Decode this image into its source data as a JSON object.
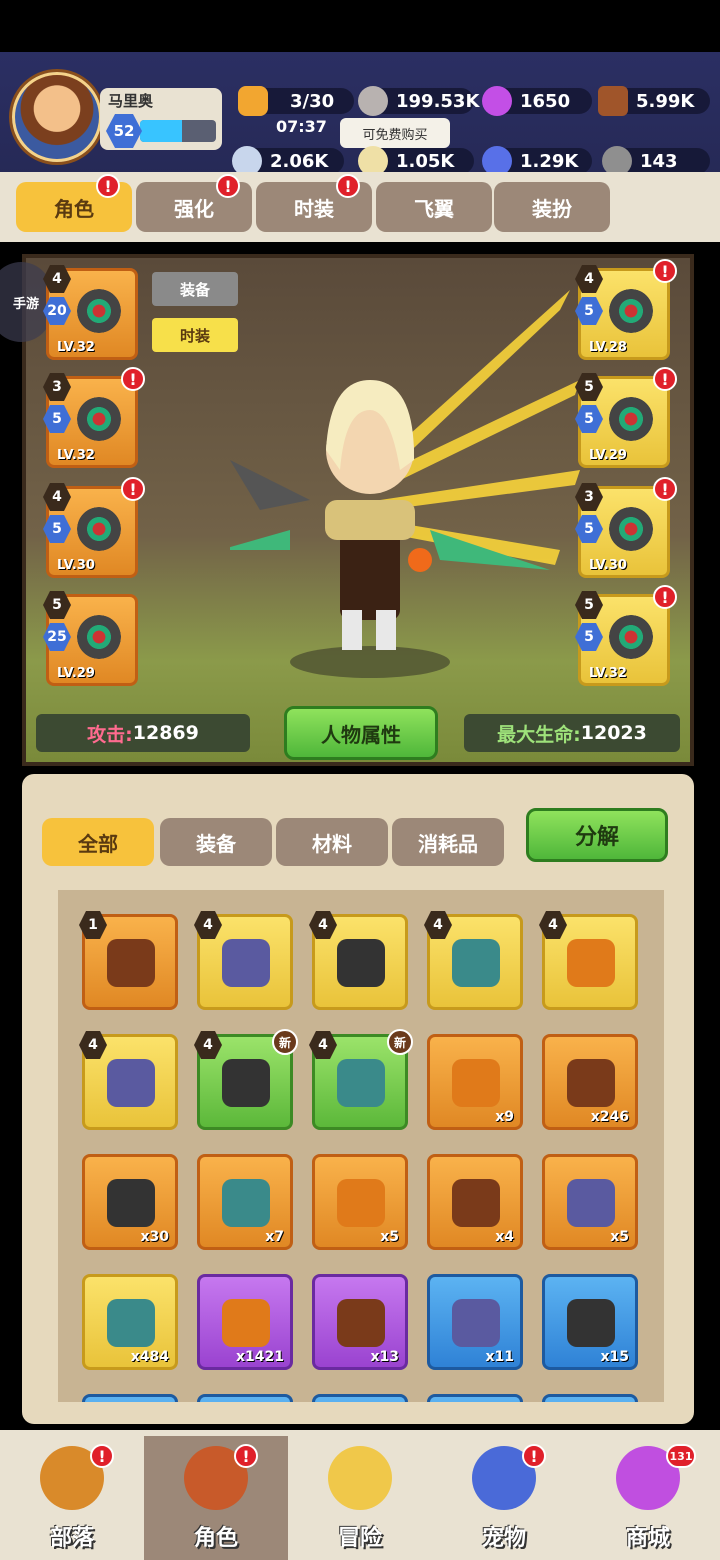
{
  "player": {
    "name": "马里奥",
    "level": "52",
    "xp_fraction": 0.55
  },
  "resources": {
    "stamina": "3/30",
    "timer": "07:37",
    "ore": "199.53K",
    "gems": "1650",
    "wood": "5.99K",
    "bone": "2.06K",
    "egg": "1.05K",
    "crystal": "1.29K",
    "stone": "143",
    "free_tooltip": "可免费购买"
  },
  "tabs": [
    {
      "label": "角色",
      "alert": "!"
    },
    {
      "label": "强化",
      "alert": "!"
    },
    {
      "label": "时装",
      "alert": "!"
    },
    {
      "label": "飞翼",
      "alert": ""
    },
    {
      "label": "装扮",
      "alert": ""
    }
  ],
  "side_tag": "手游",
  "mode_buttons": {
    "equip": "装备",
    "fashion": "时装"
  },
  "left_slots": [
    {
      "star": "4",
      "level": "20",
      "lv": "LV.32"
    },
    {
      "star": "3",
      "level": "5",
      "lv": "LV.32"
    },
    {
      "star": "4",
      "level": "5",
      "lv": "LV.30"
    },
    {
      "star": "5",
      "level": "25",
      "lv": "LV.29"
    }
  ],
  "right_slots": [
    {
      "star": "4",
      "level": "5",
      "lv": "LV.28"
    },
    {
      "star": "5",
      "level": "5",
      "lv": "LV.29"
    },
    {
      "star": "3",
      "level": "5",
      "lv": "LV.30"
    },
    {
      "star": "5",
      "level": "5",
      "lv": "LV.32"
    }
  ],
  "stats": {
    "attack_label": "攻击:",
    "attack": "12869",
    "attr_button": "人物属性",
    "hp_label": "最大生命:",
    "hp": "12023"
  },
  "filter_tabs": [
    "全部",
    "装备",
    "材料",
    "消耗品"
  ],
  "decompose": "分解",
  "items_row1": [
    {
      "star": "1",
      "color": "orange"
    },
    {
      "star": "4",
      "color": "yellow"
    },
    {
      "star": "4",
      "color": "yellow"
    },
    {
      "star": "4",
      "color": "yellow"
    },
    {
      "star": "4",
      "color": "yellow"
    }
  ],
  "items_row2": [
    {
      "star": "4",
      "color": "yellow",
      "badge": "",
      "count": ""
    },
    {
      "star": "4",
      "color": "green",
      "badge": "新",
      "count": ""
    },
    {
      "star": "4",
      "color": "green",
      "badge": "新",
      "count": ""
    },
    {
      "star": "",
      "color": "orange",
      "badge": "",
      "count": "x9"
    },
    {
      "star": "",
      "color": "orange",
      "badge": "",
      "count": "x246"
    }
  ],
  "items_row3": [
    {
      "color": "orange",
      "count": "x30"
    },
    {
      "color": "orange",
      "count": "x7"
    },
    {
      "color": "orange",
      "count": "x5"
    },
    {
      "color": "orange",
      "count": "x4"
    },
    {
      "color": "orange",
      "count": "x5"
    }
  ],
  "items_row4": [
    {
      "color": "yellow",
      "count": "x484"
    },
    {
      "color": "purple",
      "count": "x1421"
    },
    {
      "color": "purple",
      "count": "x13"
    },
    {
      "color": "blue",
      "count": "x11"
    },
    {
      "color": "blue",
      "count": "x15"
    }
  ],
  "nav": [
    {
      "label": "部落",
      "badge": "!"
    },
    {
      "label": "角色",
      "badge": "!"
    },
    {
      "label": "冒险",
      "badge": ""
    },
    {
      "label": "宠物",
      "badge": "!"
    },
    {
      "label": "商城",
      "badge": "131"
    }
  ]
}
